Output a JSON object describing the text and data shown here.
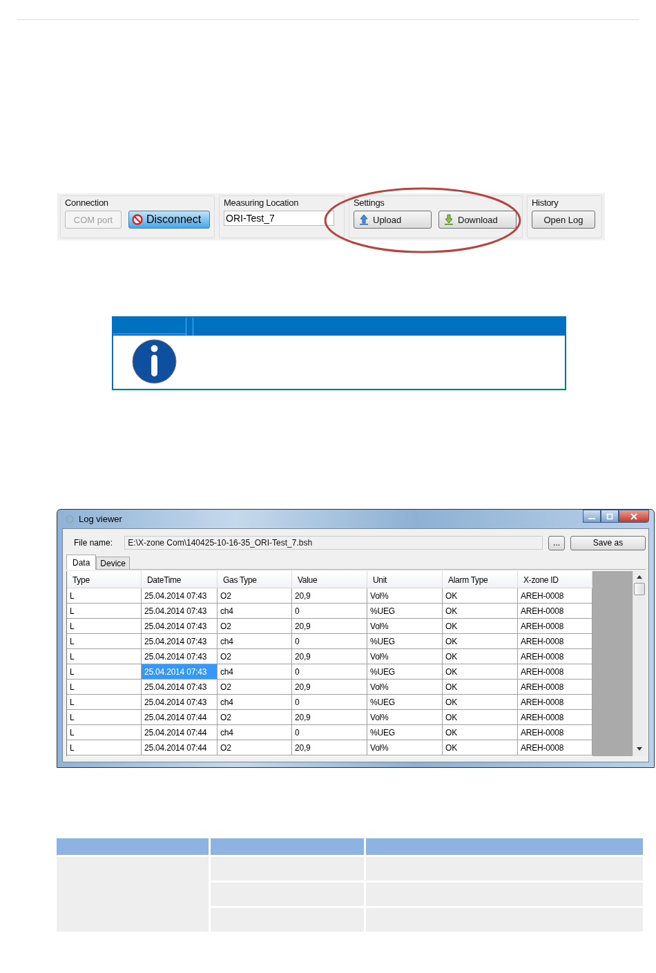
{
  "toolbar": {
    "groups": [
      {
        "title": "Connection",
        "items": [
          {
            "kind": "button",
            "label": "COM port",
            "disabled": true
          },
          {
            "kind": "primary",
            "label": "Disconnect",
            "disabled": false
          }
        ]
      },
      {
        "title": "Measuring Location",
        "items": [
          {
            "kind": "field",
            "label": "ORI-Test_7"
          }
        ]
      },
      {
        "title": "Settings",
        "items": [
          {
            "kind": "upload",
            "label": "Upload"
          },
          {
            "kind": "download",
            "label": "Download"
          }
        ]
      },
      {
        "title": "History",
        "items": [
          {
            "kind": "button",
            "label": "Open Log",
            "disabled": false
          }
        ]
      }
    ]
  },
  "log_viewer": {
    "title": "Log viewer",
    "file_label": "File name:",
    "file_path": "E:\\X-zone Com\\140425-10-16-35_ORI-Test_7.bsh",
    "browse_button": "...",
    "save_button": "Save as",
    "tabs": [
      {
        "label": "Data",
        "selected": true
      },
      {
        "label": "Device",
        "selected": false
      }
    ],
    "columns": [
      "Type",
      "DateTime",
      "Gas Type",
      "Value",
      "Unit",
      "Alarm Type",
      "X-zone ID"
    ],
    "rows": [
      {
        "cells": [
          "L",
          "25.04.2014 07:43",
          "O2",
          "20,9",
          "Vol%",
          "OK",
          "AREH-0008"
        ],
        "selected": false
      },
      {
        "cells": [
          "L",
          "25.04.2014 07:43",
          "ch4",
          "0",
          "%UEG",
          "OK",
          "AREH-0008"
        ],
        "selected": false
      },
      {
        "cells": [
          "L",
          "25.04.2014 07:43",
          "O2",
          "20,9",
          "Vol%",
          "OK",
          "AREH-0008"
        ],
        "selected": false
      },
      {
        "cells": [
          "L",
          "25.04.2014 07:43",
          "ch4",
          "0",
          "%UEG",
          "OK",
          "AREH-0008"
        ],
        "selected": false
      },
      {
        "cells": [
          "L",
          "25.04.2014 07:43",
          "O2",
          "20,9",
          "Vol%",
          "OK",
          "AREH-0008"
        ],
        "selected": false
      },
      {
        "cells": [
          "L",
          "25.04.2014 07:43",
          "ch4",
          "0",
          "%UEG",
          "OK",
          "AREH-0008"
        ],
        "selected": true
      },
      {
        "cells": [
          "L",
          "25.04.2014 07:43",
          "O2",
          "20,9",
          "Vol%",
          "OK",
          "AREH-0008"
        ],
        "selected": false
      },
      {
        "cells": [
          "L",
          "25.04.2014 07:43",
          "ch4",
          "0",
          "%UEG",
          "OK",
          "AREH-0008"
        ],
        "selected": false
      },
      {
        "cells": [
          "L",
          "25.04.2014 07:44",
          "O2",
          "20,9",
          "Vol%",
          "OK",
          "AREH-0008"
        ],
        "selected": false
      },
      {
        "cells": [
          "L",
          "25.04.2014 07:44",
          "ch4",
          "0",
          "%UEG",
          "OK",
          "AREH-0008"
        ],
        "selected": false
      },
      {
        "cells": [
          "L",
          "25.04.2014 07:44",
          "O2",
          "20,9",
          "Vol%",
          "OK",
          "AREH-0008"
        ],
        "selected": false
      }
    ]
  }
}
